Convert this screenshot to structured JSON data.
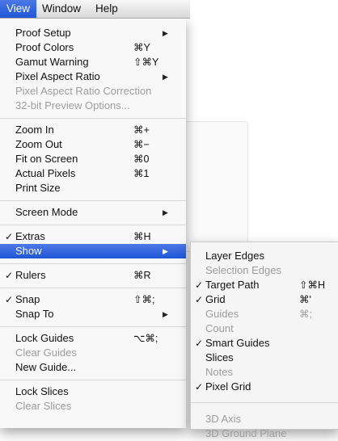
{
  "menubar": {
    "items": [
      {
        "label": "View",
        "active": true
      },
      {
        "label": "Window",
        "active": false
      },
      {
        "label": "Help",
        "active": false
      }
    ]
  },
  "view_menu": {
    "items": [
      {
        "label": "Proof Setup",
        "shortcut": "",
        "check": "",
        "submenu": true,
        "disabled": false
      },
      {
        "label": "Proof Colors",
        "shortcut": "⌘Y",
        "check": "",
        "submenu": false,
        "disabled": false
      },
      {
        "label": "Gamut Warning",
        "shortcut": "⇧⌘Y",
        "check": "",
        "submenu": false,
        "disabled": false
      },
      {
        "label": "Pixel Aspect Ratio",
        "shortcut": "",
        "check": "",
        "submenu": true,
        "disabled": false
      },
      {
        "label": "Pixel Aspect Ratio Correction",
        "shortcut": "",
        "check": "",
        "submenu": false,
        "disabled": true
      },
      {
        "label": "32-bit Preview Options...",
        "shortcut": "",
        "check": "",
        "submenu": false,
        "disabled": true
      },
      {
        "label": "Zoom In",
        "shortcut": "⌘+",
        "check": "",
        "submenu": false,
        "disabled": false
      },
      {
        "label": "Zoom Out",
        "shortcut": "⌘−",
        "check": "",
        "submenu": false,
        "disabled": false
      },
      {
        "label": "Fit on Screen",
        "shortcut": "⌘0",
        "check": "",
        "submenu": false,
        "disabled": false
      },
      {
        "label": "Actual Pixels",
        "shortcut": "⌘1",
        "check": "",
        "submenu": false,
        "disabled": false
      },
      {
        "label": "Print Size",
        "shortcut": "",
        "check": "",
        "submenu": false,
        "disabled": false
      },
      {
        "label": "Screen Mode",
        "shortcut": "",
        "check": "",
        "submenu": true,
        "disabled": false
      },
      {
        "label": "Extras",
        "shortcut": "⌘H",
        "check": "✓",
        "submenu": false,
        "disabled": false
      },
      {
        "label": "Show",
        "shortcut": "",
        "check": "",
        "submenu": true,
        "disabled": false,
        "highlight": true
      },
      {
        "label": "Rulers",
        "shortcut": "⌘R",
        "check": "✓",
        "submenu": false,
        "disabled": false
      },
      {
        "label": "Snap",
        "shortcut": "⇧⌘;",
        "check": "✓",
        "submenu": false,
        "disabled": false
      },
      {
        "label": "Snap To",
        "shortcut": "",
        "check": "",
        "submenu": true,
        "disabled": false
      },
      {
        "label": "Lock Guides",
        "shortcut": "⌥⌘;",
        "check": "",
        "submenu": false,
        "disabled": false
      },
      {
        "label": "Clear Guides",
        "shortcut": "",
        "check": "",
        "submenu": false,
        "disabled": true
      },
      {
        "label": "New Guide...",
        "shortcut": "",
        "check": "",
        "submenu": false,
        "disabled": false
      },
      {
        "label": "Lock Slices",
        "shortcut": "",
        "check": "",
        "submenu": false,
        "disabled": false
      },
      {
        "label": "Clear Slices",
        "shortcut": "",
        "check": "",
        "submenu": false,
        "disabled": true
      }
    ]
  },
  "show_submenu": {
    "items": [
      {
        "label": "Layer Edges",
        "shortcut": "",
        "check": "",
        "disabled": false
      },
      {
        "label": "Selection Edges",
        "shortcut": "",
        "check": "",
        "disabled": true
      },
      {
        "label": "Target Path",
        "shortcut": "⇧⌘H",
        "check": "✓",
        "disabled": false
      },
      {
        "label": "Grid",
        "shortcut": "⌘'",
        "check": "✓",
        "disabled": false
      },
      {
        "label": "Guides",
        "shortcut": "⌘;",
        "check": "",
        "disabled": true
      },
      {
        "label": "Count",
        "shortcut": "",
        "check": "",
        "disabled": true
      },
      {
        "label": "Smart Guides",
        "shortcut": "",
        "check": "✓",
        "disabled": false
      },
      {
        "label": "Slices",
        "shortcut": "",
        "check": "",
        "disabled": false
      },
      {
        "label": "Notes",
        "shortcut": "",
        "check": "",
        "disabled": true
      },
      {
        "label": "Pixel Grid",
        "shortcut": "",
        "check": "✓",
        "disabled": false
      },
      {
        "label": "3D Axis",
        "shortcut": "",
        "check": "",
        "disabled": true
      },
      {
        "label": "3D Ground Plane",
        "shortcut": "",
        "check": "",
        "disabled": true
      }
    ]
  },
  "icons": {
    "submenu_arrow": "triangle-right-icon",
    "checkmark": "checkmark-icon"
  },
  "colors": {
    "highlight": "#2c62dc",
    "disabled_text": "#9d9d9d"
  }
}
